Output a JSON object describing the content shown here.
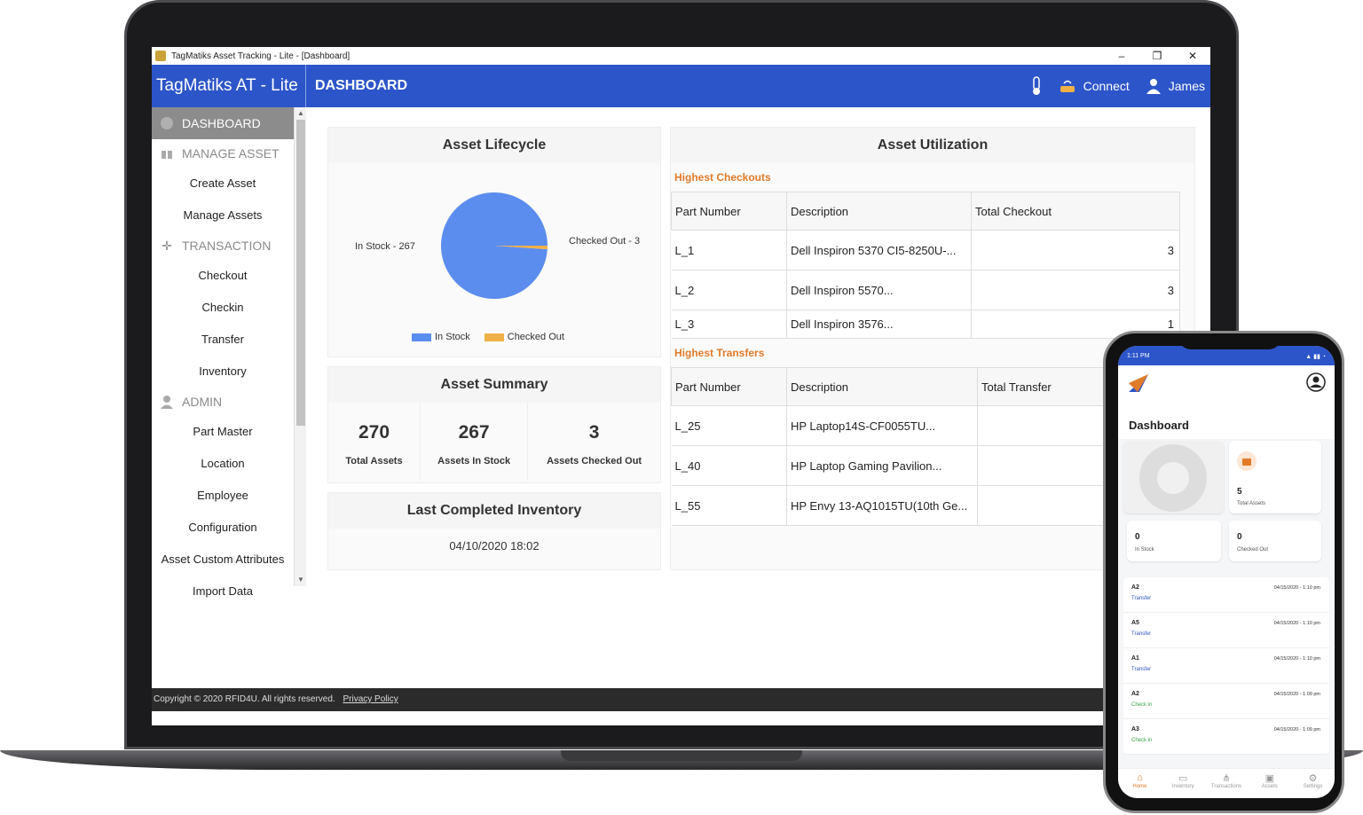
{
  "window": {
    "title": "TagMatiks Asset Tracking - Lite - [Dashboard]",
    "minimize": "–",
    "restore": "❐",
    "close": "✕"
  },
  "header": {
    "brand": "TagMatiks AT - Lite",
    "page": "DASHBOARD",
    "connect": "Connect",
    "user": "James"
  },
  "sidebar": {
    "dashboard": "DASHBOARD",
    "manage_asset": "MANAGE ASSET",
    "create_asset": "Create Asset",
    "manage_assets": "Manage Assets",
    "transaction": "TRANSACTION",
    "checkout": "Checkout",
    "checkin": "Checkin",
    "transfer": "Transfer",
    "inventory": "Inventory",
    "admin": "ADMIN",
    "part_master": "Part Master",
    "location": "Location",
    "employee": "Employee",
    "configuration": "Configuration",
    "custom_attributes": "Asset Custom Attributes",
    "import_data": "Import Data"
  },
  "lifecycle": {
    "title": "Asset Lifecycle",
    "label_in": "In Stock - 267",
    "label_out": "Checked Out - 3",
    "legend_in": "In Stock",
    "legend_out": "Checked Out"
  },
  "chart_data": {
    "type": "pie",
    "title": "Asset Lifecycle",
    "categories": [
      "In Stock",
      "Checked Out"
    ],
    "values": [
      267,
      3
    ],
    "colors": [
      "#5b8dee",
      "#f0b048"
    ],
    "legend": "bottom"
  },
  "summary": {
    "title": "Asset Summary",
    "total_val": "270",
    "total_lbl": "Total Assets",
    "in_val": "267",
    "in_lbl": "Assets In Stock",
    "out_val": "3",
    "out_lbl": "Assets Checked Out"
  },
  "inventory": {
    "title": "Last Completed Inventory",
    "date": "04/10/2020 18:02"
  },
  "utilization": {
    "title": "Asset Utilization",
    "checkouts_title": "Highest Checkouts",
    "checkouts_headers": [
      "Part Number",
      "Description",
      "Total Checkout"
    ],
    "checkouts": [
      [
        "L_1",
        "Dell Inspiron 5370 CI5-8250U-...",
        "3"
      ],
      [
        "L_2",
        "Dell Inspiron 5570...",
        "3"
      ],
      [
        "L_3",
        "Dell Inspiron 3576...",
        "1"
      ]
    ],
    "transfers_title": "Highest Transfers",
    "transfers_headers": [
      "Part Number",
      "Description",
      "Total Transfer"
    ],
    "transfers": [
      [
        "L_25",
        "HP Laptop14S-CF0055TU...",
        ""
      ],
      [
        "L_40",
        "HP Laptop Gaming Pavilion...",
        ""
      ],
      [
        "L_55",
        "HP Envy 13-AQ1015TU(10th Ge...",
        ""
      ]
    ]
  },
  "footer": {
    "copyright": "Copyright © 2020 RFID4U. All rights reserved.",
    "privacy": "Privacy Policy"
  },
  "phone": {
    "time": "1:11 PM",
    "title": "Dashboard",
    "total_val": "5",
    "total_lbl": "Total Assets",
    "in_val": "0",
    "in_lbl": "In Stock",
    "out_val": "0",
    "out_lbl": "Checked Out",
    "items": [
      {
        "asset": "A2",
        "type": "Transfer",
        "date": "04/15/2020 - 1:10 pm"
      },
      {
        "asset": "A5",
        "type": "Transfer",
        "date": "04/15/2020 - 1:10 pm"
      },
      {
        "asset": "A1",
        "type": "Transfer",
        "date": "04/15/2020 - 1:10 pm"
      },
      {
        "asset": "A2",
        "type": "Check in",
        "date": "04/15/2020 - 1:09 pm"
      },
      {
        "asset": "A3",
        "type": "Check in",
        "date": "04/15/2020 - 1:09 pm"
      }
    ],
    "tabs": [
      "Home",
      "Inventory",
      "Transactions",
      "Assets",
      "Settings"
    ]
  }
}
